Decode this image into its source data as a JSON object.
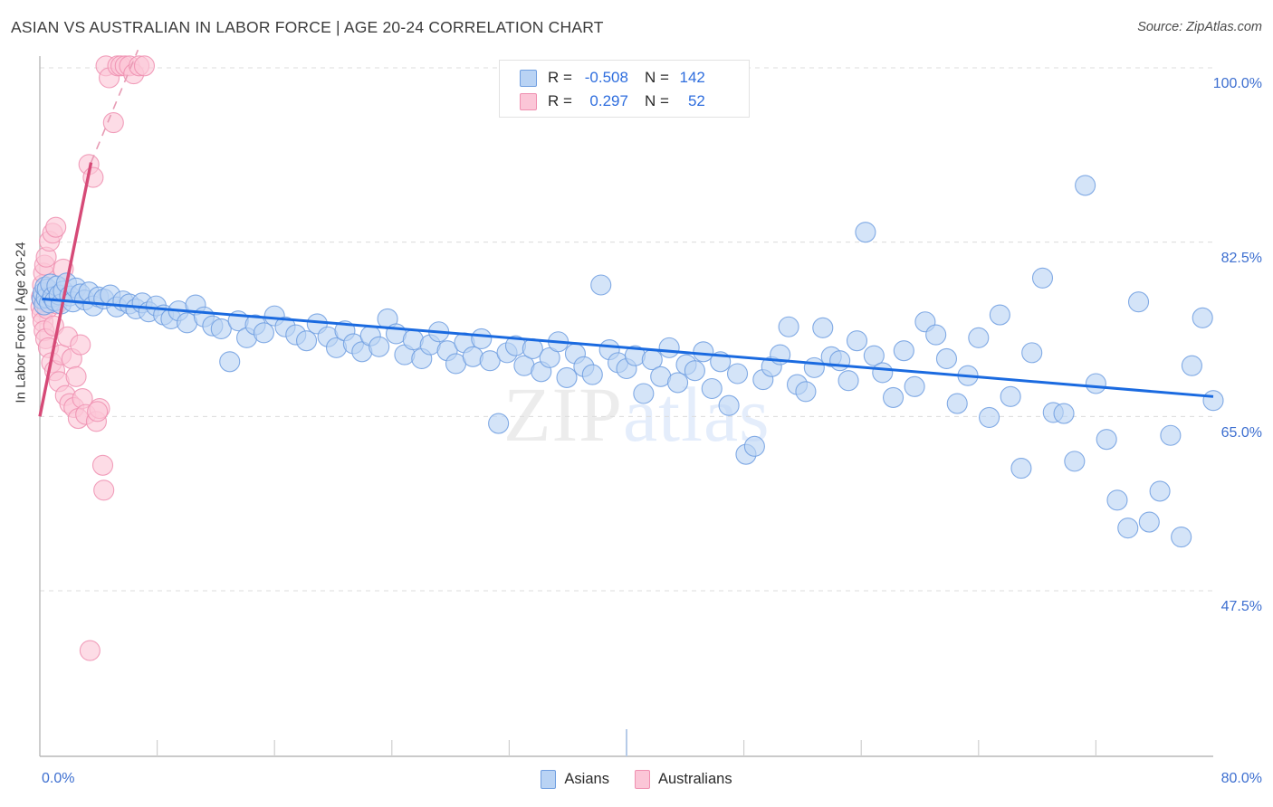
{
  "header": {
    "title": "ASIAN VS AUSTRALIAN IN LABOR FORCE | AGE 20-24 CORRELATION CHART",
    "source": "Source: ZipAtlas.com"
  },
  "watermark": {
    "part1": "ZIP",
    "part2": "atlas"
  },
  "correlation_legend": {
    "rows": [
      {
        "series": "Asians",
        "color": "#b9d3f4",
        "r_label": "R =",
        "r_value": "-0.508",
        "n_label": "N =",
        "n_value": "142"
      },
      {
        "series": "Australians",
        "color": "#fbc6d7",
        "r_label": "R =",
        "r_value": "0.297",
        "n_label": "N =",
        "n_value": "52"
      }
    ]
  },
  "series_legend": [
    {
      "label": "Asians",
      "color": "#b9d3f4"
    },
    {
      "label": "Australians",
      "color": "#fbc6d7"
    }
  ],
  "axes": {
    "y_title": "In Labor Force | Age 20-24",
    "y_ticks": [
      "100.0%",
      "82.5%",
      "65.0%",
      "47.5%"
    ],
    "x_ticks": [
      "0.0%",
      "80.0%"
    ]
  },
  "chart_data": {
    "type": "scatter",
    "title": "ASIAN VS AUSTRALIAN IN LABOR FORCE | AGE 20-24 CORRELATION CHART",
    "xlabel": "",
    "ylabel": "In Labor Force | Age 20-24",
    "xlim": [
      0.0,
      80.0
    ],
    "ylim": [
      30.0,
      103.0
    ],
    "x_tick_values": [
      0.0,
      80.0
    ],
    "y_tick_values": [
      100.0,
      82.5,
      65.0,
      47.5
    ],
    "grid": "horizontal-dashed",
    "legend_position": "bottom-center",
    "series": [
      {
        "name": "Asians",
        "color": "#b9d3f4",
        "edge_color": "#6f9ee0",
        "R": -0.508,
        "N": 142,
        "trend": {
          "color": "#1a6ae0",
          "x0": 0.0,
          "y0": 76.8,
          "x1": 74.5,
          "y1": 67.0,
          "style": "solid"
        },
        "points": [
          [
            0.2,
            76.8
          ],
          [
            0.3,
            77.4
          ],
          [
            0.4,
            76.2
          ],
          [
            0.5,
            78.0
          ],
          [
            0.6,
            76.9
          ],
          [
            0.7,
            77.8
          ],
          [
            0.9,
            76.4
          ],
          [
            1.0,
            78.3
          ],
          [
            1.2,
            77.0
          ],
          [
            1.4,
            76.6
          ],
          [
            1.6,
            78.1
          ],
          [
            1.8,
            77.2
          ],
          [
            2.0,
            76.3
          ],
          [
            2.2,
            77.6
          ],
          [
            2.5,
            78.4
          ],
          [
            2.8,
            77.1
          ],
          [
            3.1,
            76.5
          ],
          [
            3.4,
            77.9
          ],
          [
            3.8,
            77.3
          ],
          [
            4.2,
            76.7
          ],
          [
            4.6,
            77.5
          ],
          [
            5.0,
            76.1
          ],
          [
            5.5,
            77.0
          ],
          [
            6.0,
            76.8
          ],
          [
            6.6,
            77.2
          ],
          [
            7.2,
            76.0
          ],
          [
            7.8,
            76.6
          ],
          [
            8.4,
            76.3
          ],
          [
            9.0,
            75.8
          ],
          [
            9.6,
            76.4
          ],
          [
            10.2,
            75.5
          ],
          [
            10.9,
            76.1
          ],
          [
            11.6,
            75.2
          ],
          [
            12.3,
            74.8
          ],
          [
            13.0,
            75.6
          ],
          [
            13.8,
            74.4
          ],
          [
            14.6,
            76.2
          ],
          [
            15.4,
            75.0
          ],
          [
            16.2,
            74.1
          ],
          [
            17.0,
            73.8
          ],
          [
            17.8,
            70.5
          ],
          [
            18.6,
            74.6
          ],
          [
            19.4,
            72.9
          ],
          [
            20.2,
            74.2
          ],
          [
            21.0,
            73.4
          ],
          [
            22.0,
            75.1
          ],
          [
            23.0,
            74.0
          ],
          [
            24.0,
            73.2
          ],
          [
            25.0,
            72.6
          ],
          [
            26.0,
            74.3
          ],
          [
            27.0,
            73.0
          ],
          [
            27.8,
            71.9
          ],
          [
            28.6,
            73.6
          ],
          [
            29.4,
            72.3
          ],
          [
            30.2,
            71.5
          ],
          [
            31.0,
            73.1
          ],
          [
            31.8,
            72.0
          ],
          [
            32.6,
            74.8
          ],
          [
            33.4,
            73.3
          ],
          [
            34.2,
            71.2
          ],
          [
            35.0,
            72.7
          ],
          [
            35.8,
            70.8
          ],
          [
            36.6,
            72.2
          ],
          [
            37.4,
            73.5
          ],
          [
            38.2,
            71.6
          ],
          [
            39.0,
            70.3
          ],
          [
            39.8,
            72.4
          ],
          [
            40.6,
            71.0
          ],
          [
            41.4,
            72.8
          ],
          [
            42.2,
            70.6
          ],
          [
            43.0,
            64.3
          ],
          [
            43.8,
            71.4
          ],
          [
            44.6,
            72.1
          ],
          [
            45.4,
            70.1
          ],
          [
            46.2,
            71.8
          ],
          [
            47.0,
            69.5
          ],
          [
            47.8,
            70.9
          ],
          [
            48.6,
            72.5
          ],
          [
            49.4,
            68.9
          ],
          [
            50.2,
            71.3
          ],
          [
            51.0,
            70.0
          ],
          [
            51.8,
            69.2
          ],
          [
            52.6,
            78.2
          ],
          [
            53.4,
            71.7
          ],
          [
            54.2,
            70.4
          ],
          [
            55.0,
            69.8
          ],
          [
            55.8,
            71.1
          ],
          [
            56.6,
            67.3
          ],
          [
            57.4,
            70.7
          ],
          [
            58.2,
            69.0
          ],
          [
            59.0,
            71.9
          ],
          [
            59.8,
            68.4
          ],
          [
            60.6,
            70.2
          ],
          [
            61.4,
            69.6
          ],
          [
            62.2,
            71.5
          ],
          [
            63.0,
            67.8
          ],
          [
            63.8,
            70.5
          ],
          [
            64.6,
            66.1
          ],
          [
            65.4,
            69.3
          ],
          [
            66.2,
            61.2
          ],
          [
            67.0,
            62.0
          ],
          [
            67.8,
            68.7
          ],
          [
            68.6,
            70.0
          ],
          [
            69.4,
            71.2
          ],
          [
            70.2,
            74.0
          ],
          [
            71.0,
            68.2
          ],
          [
            71.8,
            67.5
          ],
          [
            72.6,
            69.9
          ],
          [
            73.4,
            73.9
          ],
          [
            74.2,
            71.0
          ],
          [
            75.0,
            70.6
          ],
          [
            75.8,
            68.6
          ],
          [
            76.6,
            72.6
          ],
          [
            77.4,
            83.5
          ],
          [
            78.2,
            71.1
          ],
          [
            79.0,
            69.4
          ],
          [
            80.0,
            66.9
          ],
          [
            81.0,
            71.6
          ],
          [
            82.0,
            68.0
          ],
          [
            83.0,
            74.5
          ],
          [
            84.0,
            73.2
          ],
          [
            85.0,
            70.8
          ],
          [
            86.0,
            66.3
          ],
          [
            87.0,
            69.1
          ],
          [
            88.0,
            72.9
          ],
          [
            89.0,
            64.9
          ],
          [
            90.0,
            75.2
          ],
          [
            91.0,
            67.0
          ],
          [
            92.0,
            59.8
          ],
          [
            93.0,
            71.4
          ],
          [
            94.0,
            78.9
          ],
          [
            95.0,
            65.4
          ],
          [
            96.0,
            65.3
          ],
          [
            97.0,
            60.5
          ],
          [
            98.0,
            88.2
          ],
          [
            99.0,
            68.3
          ],
          [
            100.0,
            62.7
          ],
          [
            101.0,
            56.6
          ],
          [
            102.0,
            53.8
          ],
          [
            103.0,
            76.5
          ],
          [
            104.0,
            54.4
          ],
          [
            105.0,
            57.5
          ],
          [
            106.0,
            63.1
          ],
          [
            107.0,
            52.9
          ],
          [
            108.0,
            70.1
          ],
          [
            109.0,
            74.9
          ],
          [
            110.0,
            66.6
          ]
        ]
      },
      {
        "name": "Australians",
        "color": "#fbc6d7",
        "edge_color": "#ef8fb0",
        "R": 0.297,
        "N": 52,
        "trend": {
          "color": "#d64a77",
          "x0": 0.0,
          "y0": 72.0,
          "x1": 4.5,
          "y1": 89.0,
          "style": "solid-then-dashed",
          "dash_to": [
            8.5,
            101.5
          ]
        },
        "points": [
          [
            0.1,
            76.0
          ],
          [
            0.15,
            77.0
          ],
          [
            0.2,
            75.3
          ],
          [
            0.25,
            78.2
          ],
          [
            0.3,
            74.5
          ],
          [
            0.35,
            79.4
          ],
          [
            0.4,
            73.6
          ],
          [
            0.45,
            80.2
          ],
          [
            0.5,
            76.5
          ],
          [
            0.55,
            72.8
          ],
          [
            0.6,
            81.0
          ],
          [
            0.7,
            75.8
          ],
          [
            0.8,
            71.9
          ],
          [
            0.9,
            82.6
          ],
          [
            1.0,
            77.6
          ],
          [
            1.1,
            70.4
          ],
          [
            1.2,
            83.4
          ],
          [
            1.3,
            74.1
          ],
          [
            1.4,
            69.6
          ],
          [
            1.5,
            84.0
          ],
          [
            1.6,
            76.3
          ],
          [
            1.8,
            68.5
          ],
          [
            2.0,
            71.2
          ],
          [
            2.2,
            79.8
          ],
          [
            2.4,
            67.1
          ],
          [
            2.6,
            73.0
          ],
          [
            2.8,
            66.3
          ],
          [
            3.0,
            70.8
          ],
          [
            3.2,
            65.9
          ],
          [
            3.4,
            69.0
          ],
          [
            3.6,
            64.8
          ],
          [
            3.8,
            72.2
          ],
          [
            4.0,
            66.8
          ],
          [
            4.3,
            65.2
          ],
          [
            4.6,
            90.3
          ],
          [
            5.0,
            89.0
          ],
          [
            5.3,
            64.5
          ],
          [
            5.6,
            65.8
          ],
          [
            5.9,
            60.1
          ],
          [
            6.2,
            100.2
          ],
          [
            6.5,
            99.0
          ],
          [
            6.9,
            94.5
          ],
          [
            7.3,
            100.2
          ],
          [
            7.6,
            100.2
          ],
          [
            8.0,
            100.2
          ],
          [
            8.4,
            100.2
          ],
          [
            8.8,
            99.4
          ],
          [
            9.3,
            100.2
          ],
          [
            9.8,
            100.2
          ],
          [
            6.0,
            57.6
          ],
          [
            4.7,
            41.5
          ],
          [
            5.4,
            65.5
          ]
        ]
      }
    ]
  }
}
